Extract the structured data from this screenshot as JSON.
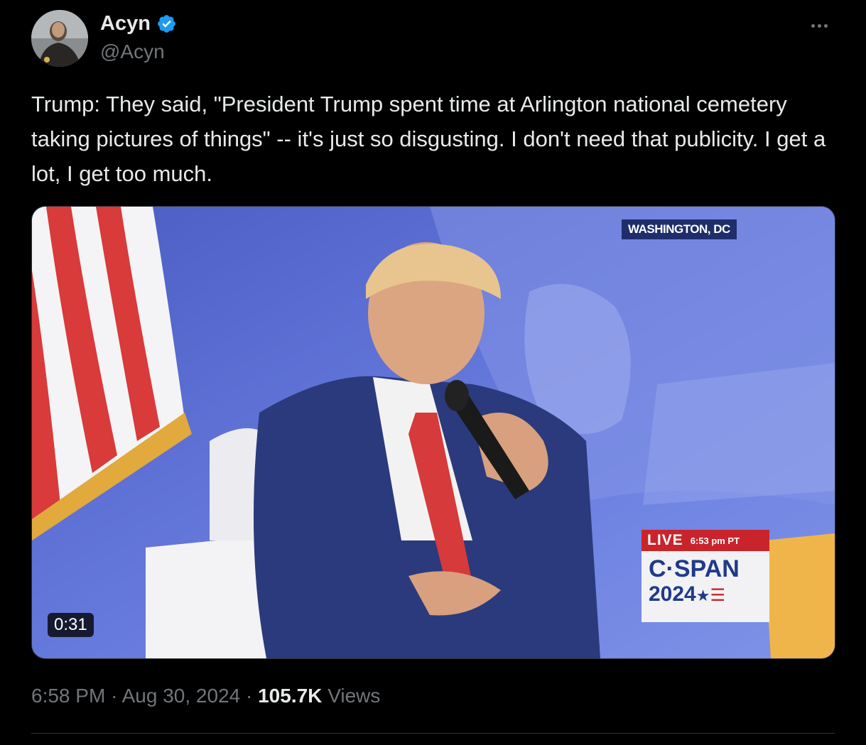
{
  "author": {
    "display_name": "Acyn",
    "handle": "@Acyn",
    "verified": true
  },
  "icons": {
    "verified": "verified-badge-icon",
    "more": "more-options-icon"
  },
  "tweet": {
    "text": "Trump: They said, \"President Trump spent time at Arlington national cemetery taking pictures of things\" -- it's just so disgusting. I don't need that publicity. I get a lot, I get too much."
  },
  "media": {
    "duration": "0:31",
    "location": "WASHINGTON, DC",
    "live_label": "LIVE",
    "live_time": "6:53 pm PT",
    "network": "C·SPAN",
    "network_year": "2024"
  },
  "meta": {
    "time": "6:58 PM",
    "separator": "·",
    "date": "Aug 30, 2024",
    "views_count": "105.7K",
    "views_label": "Views"
  },
  "colors": {
    "background": "#000000",
    "text": "#e7e9ea",
    "muted": "#71767b",
    "verified": "#1d9bf0",
    "divider": "#2f3336"
  }
}
